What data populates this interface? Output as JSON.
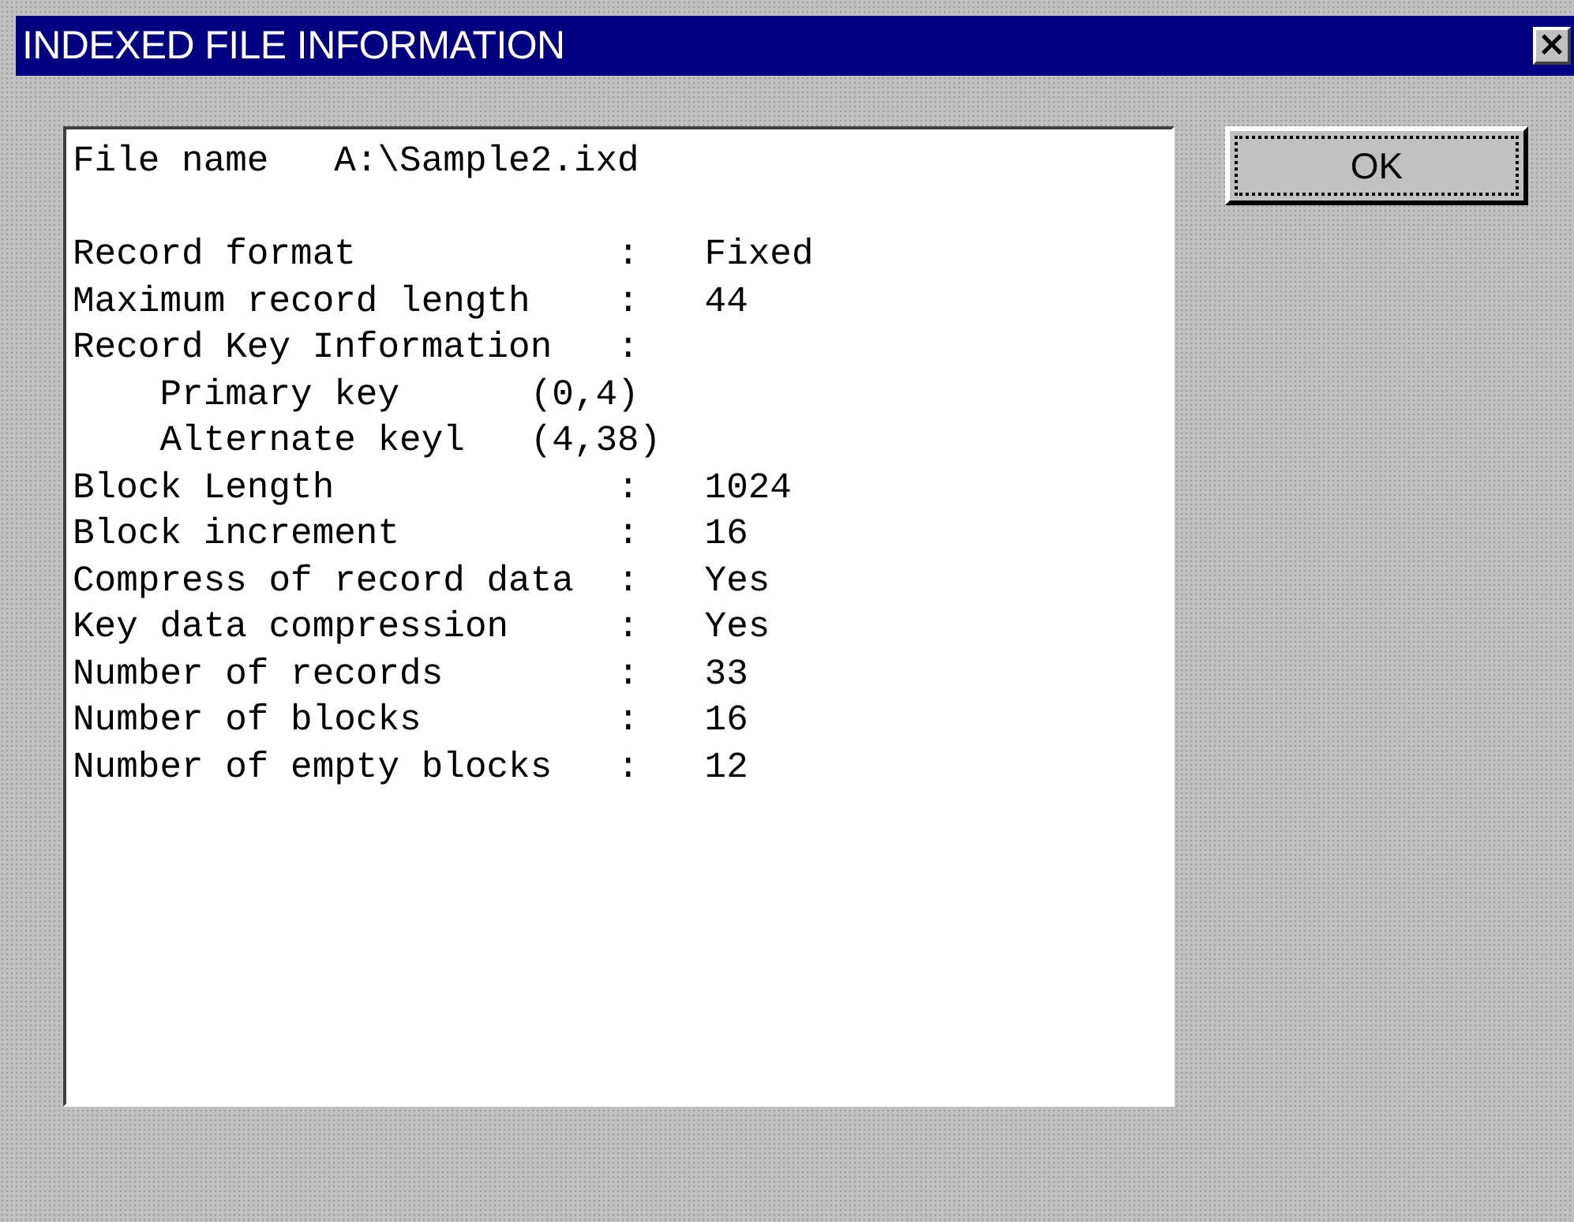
{
  "window": {
    "title": "INDEXED FILE INFORMATION",
    "close_label": "×"
  },
  "file_line": "File name   A:\\Sample2.ixd",
  "info_lines": [
    "Record format            :   Fixed",
    "Maximum record length    :   44",
    "Record Key Information   :",
    "    Primary key      (0,4)",
    "    Alternate keyl   (4,38)",
    "Block Length             :   1024",
    "Block increment          :   16",
    "Compress of record data  :   Yes",
    "Key data compression     :   Yes",
    "Number of records        :   33",
    "Number of blocks         :   16",
    "Number of empty blocks   :   12"
  ],
  "buttons": [
    {
      "label": "OK",
      "focused": true
    }
  ]
}
